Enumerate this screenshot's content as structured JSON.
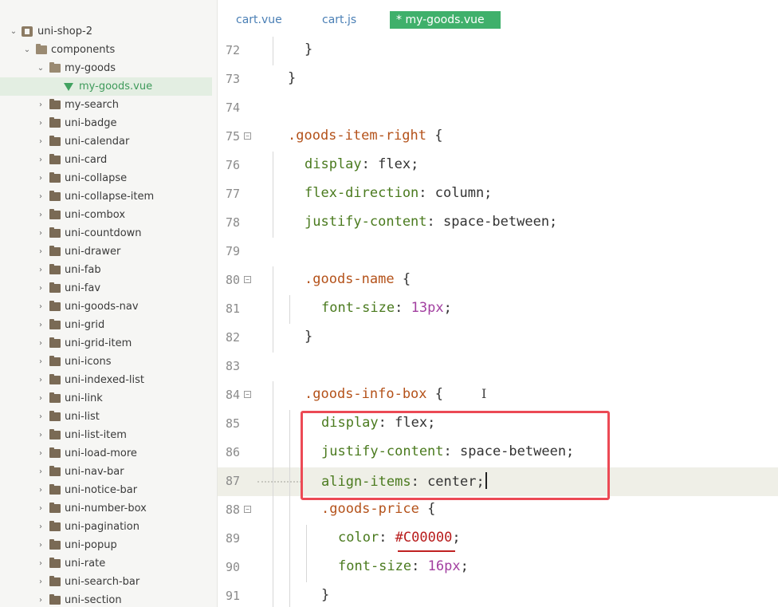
{
  "sidebar": {
    "project": "uni-shop-2",
    "folder_components": "components",
    "folder_my_goods": "my-goods",
    "file_selected": "my-goods.vue",
    "folders": [
      "my-search",
      "uni-badge",
      "uni-calendar",
      "uni-card",
      "uni-collapse",
      "uni-collapse-item",
      "uni-combox",
      "uni-countdown",
      "uni-drawer",
      "uni-fab",
      "uni-fav",
      "uni-goods-nav",
      "uni-grid",
      "uni-grid-item",
      "uni-icons",
      "uni-indexed-list",
      "uni-link",
      "uni-list",
      "uni-list-item",
      "uni-load-more",
      "uni-nav-bar",
      "uni-notice-bar",
      "uni-number-box",
      "uni-pagination",
      "uni-popup",
      "uni-rate",
      "uni-search-bar",
      "uni-section"
    ]
  },
  "tabs": [
    {
      "label": "cart.vue",
      "active": false
    },
    {
      "label": "cart.js",
      "active": false
    },
    {
      "label": "* my-goods.vue",
      "active": true
    }
  ],
  "editor": {
    "current_line": 87,
    "lines": [
      {
        "num": "72",
        "fold": false,
        "indent": 1,
        "tokens": [
          {
            "t": "}",
            "c": "t-punc"
          }
        ]
      },
      {
        "num": "73",
        "fold": false,
        "indent": 0,
        "tokens": [
          {
            "t": "}",
            "c": "t-punc"
          }
        ]
      },
      {
        "num": "74",
        "fold": false,
        "indent": 0,
        "tokens": []
      },
      {
        "num": "75",
        "fold": true,
        "indent": 0,
        "tokens": [
          {
            "t": ".goods-item-right",
            "c": "t-sel"
          },
          {
            "t": " {",
            "c": "t-punc"
          }
        ]
      },
      {
        "num": "76",
        "fold": false,
        "indent": 1,
        "tokens": [
          {
            "t": "display",
            "c": "t-prop"
          },
          {
            "t": ": flex;",
            "c": "t-val"
          }
        ]
      },
      {
        "num": "77",
        "fold": false,
        "indent": 1,
        "tokens": [
          {
            "t": "flex-direction",
            "c": "t-prop"
          },
          {
            "t": ": column;",
            "c": "t-val"
          }
        ]
      },
      {
        "num": "78",
        "fold": false,
        "indent": 1,
        "tokens": [
          {
            "t": "justify-content",
            "c": "t-prop"
          },
          {
            "t": ": space-between;",
            "c": "t-val"
          }
        ]
      },
      {
        "num": "79",
        "fold": false,
        "indent": 0,
        "tokens": []
      },
      {
        "num": "80",
        "fold": true,
        "indent": 1,
        "tokens": [
          {
            "t": ".goods-name",
            "c": "t-sel"
          },
          {
            "t": " {",
            "c": "t-punc"
          }
        ]
      },
      {
        "num": "81",
        "fold": false,
        "indent": 2,
        "tokens": [
          {
            "t": "font-size",
            "c": "t-prop"
          },
          {
            "t": ": ",
            "c": "t-val"
          },
          {
            "t": "13",
            "c": "t-num"
          },
          {
            "t": "px",
            "c": "t-num"
          },
          {
            "t": ";",
            "c": "t-val"
          }
        ]
      },
      {
        "num": "82",
        "fold": false,
        "indent": 1,
        "tokens": [
          {
            "t": "}",
            "c": "t-punc"
          }
        ]
      },
      {
        "num": "83",
        "fold": false,
        "indent": 0,
        "tokens": []
      },
      {
        "num": "84",
        "fold": true,
        "indent": 1,
        "tokens": [
          {
            "t": ".goods-info-box",
            "c": "t-sel"
          },
          {
            "t": " {",
            "c": "t-punc"
          }
        ]
      },
      {
        "num": "85",
        "fold": false,
        "indent": 2,
        "tokens": [
          {
            "t": "display",
            "c": "t-prop"
          },
          {
            "t": ": flex;",
            "c": "t-val"
          }
        ]
      },
      {
        "num": "86",
        "fold": false,
        "indent": 2,
        "tokens": [
          {
            "t": "justify-content",
            "c": "t-prop"
          },
          {
            "t": ": space-between;",
            "c": "t-val"
          }
        ]
      },
      {
        "num": "87",
        "fold": false,
        "indent": 2,
        "tokens": [
          {
            "t": "align-items",
            "c": "t-prop"
          },
          {
            "t": ": center;",
            "c": "t-val"
          }
        ]
      },
      {
        "num": "88",
        "fold": true,
        "indent": 2,
        "tokens": [
          {
            "t": ".goods-price",
            "c": "t-sel"
          },
          {
            "t": " {",
            "c": "t-punc"
          }
        ]
      },
      {
        "num": "89",
        "fold": false,
        "indent": 3,
        "tokens": [
          {
            "t": "color",
            "c": "t-prop"
          },
          {
            "t": ": ",
            "c": "t-val"
          },
          {
            "t": "#C00000",
            "c": "t-color"
          },
          {
            "t": ";",
            "c": "t-val"
          }
        ]
      },
      {
        "num": "90",
        "fold": false,
        "indent": 3,
        "tokens": [
          {
            "t": "font-size",
            "c": "t-prop"
          },
          {
            "t": ": ",
            "c": "t-val"
          },
          {
            "t": "16",
            "c": "t-num"
          },
          {
            "t": "px",
            "c": "t-num"
          },
          {
            "t": ";",
            "c": "t-val"
          }
        ]
      },
      {
        "num": "91",
        "fold": false,
        "indent": 2,
        "tokens": [
          {
            "t": "}",
            "c": "t-punc"
          }
        ]
      }
    ]
  },
  "colors": {
    "accent_tab": "#3fb06b",
    "highlight_box": "#ec4a55",
    "selector": "#b4521a",
    "property": "#4a7a1e",
    "number": "#a23fa0"
  }
}
